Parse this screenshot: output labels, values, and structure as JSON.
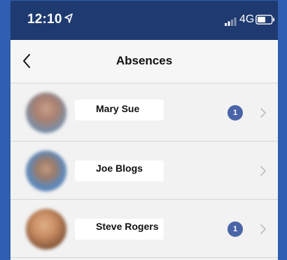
{
  "status_bar": {
    "time": "12:10",
    "network": "4G",
    "location_icon": "location-arrow-icon",
    "signal_icon": "cellular-signal-icon",
    "battery_icon": "battery-icon"
  },
  "nav": {
    "title": "Absences",
    "back_icon": "chevron-left-icon"
  },
  "absences": [
    {
      "name": "Mary Sue",
      "badge": "1"
    },
    {
      "name": "Joe Blogs",
      "badge": ""
    },
    {
      "name": "Steve Rogers",
      "badge": "1"
    }
  ],
  "colors": {
    "frame": "#2f5db0",
    "status_bar": "#1e3a70",
    "badge": "#4a64a8"
  }
}
